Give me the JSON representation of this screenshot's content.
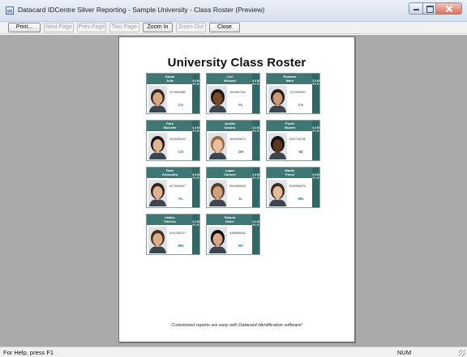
{
  "window": {
    "title": "Datacard IDCentre Silver Reporting - Sample University - Class Roster (Preview)"
  },
  "toolbar": {
    "buttons": [
      {
        "label": "Print...",
        "enabled": true
      },
      {
        "label": "Next Page",
        "enabled": false
      },
      {
        "label": "Prev Page",
        "enabled": false
      },
      {
        "label": "Two Page",
        "enabled": false
      },
      {
        "label": "Zoom In",
        "enabled": true
      },
      {
        "label": "Zoom Out",
        "enabled": false
      },
      {
        "label": "Close",
        "enabled": true
      }
    ]
  },
  "report": {
    "title": "University Class Roster",
    "footer": "Customized reports are easy with Datacard identification software!",
    "card_side_text": "SAMPLE",
    "cards": [
      {
        "last": "Doran",
        "first": "Julie",
        "id": "1079005480",
        "state": "CA",
        "skin": "#d9a882",
        "hair": "#3b2618"
      },
      {
        "last": "Levi",
        "first": "Michael",
        "id": "1023567281",
        "state": "FL",
        "skin": "#7a4a2c",
        "hair": "#1c120c"
      },
      {
        "last": "Romano",
        "first": "Mark",
        "id": "1472995091",
        "state": "CA",
        "skin": "#c99a78",
        "hair": "#2a1a10"
      },
      {
        "last": "Park",
        "first": "Michelle",
        "id": "3119055243",
        "state": "CO",
        "skin": "#e0b48e",
        "hair": "#201410"
      },
      {
        "last": "Jordan",
        "first": "Sandra",
        "id": "4020005974",
        "state": "OH",
        "skin": "#e8c0a0",
        "hair": "#9a6a3c"
      },
      {
        "last": "Poole",
        "first": "Robert",
        "id": "8107726756",
        "state": "MI",
        "skin": "#5a3520",
        "hair": "#120b07"
      },
      {
        "last": "Roth",
        "first": "Alexandra",
        "id": "6073549647",
        "state": "FL",
        "skin": "#e0b190",
        "hair": "#3a2416"
      },
      {
        "last": "Lopez",
        "first": "Carmen",
        "id": "5919365535",
        "state": "IL",
        "skin": "#cfa080",
        "hair": "#5a3a24"
      },
      {
        "last": "Martin",
        "first": "Frank",
        "id": "5200566579",
        "state": "MN",
        "skin": "#e2bc9c",
        "hair": "#3c2a1c"
      },
      {
        "last": "Valdes",
        "first": "Patricia",
        "id": "9101455247",
        "state": "MN",
        "skin": "#dcae8c",
        "hair": "#4a2e1c"
      },
      {
        "last": "Roland",
        "first": "Marie",
        "id": "9288556084",
        "state": "NY",
        "skin": "#d8a888",
        "hair": "#120c08"
      }
    ]
  },
  "status": {
    "help": "For Help, press F1",
    "num": "NUM"
  }
}
